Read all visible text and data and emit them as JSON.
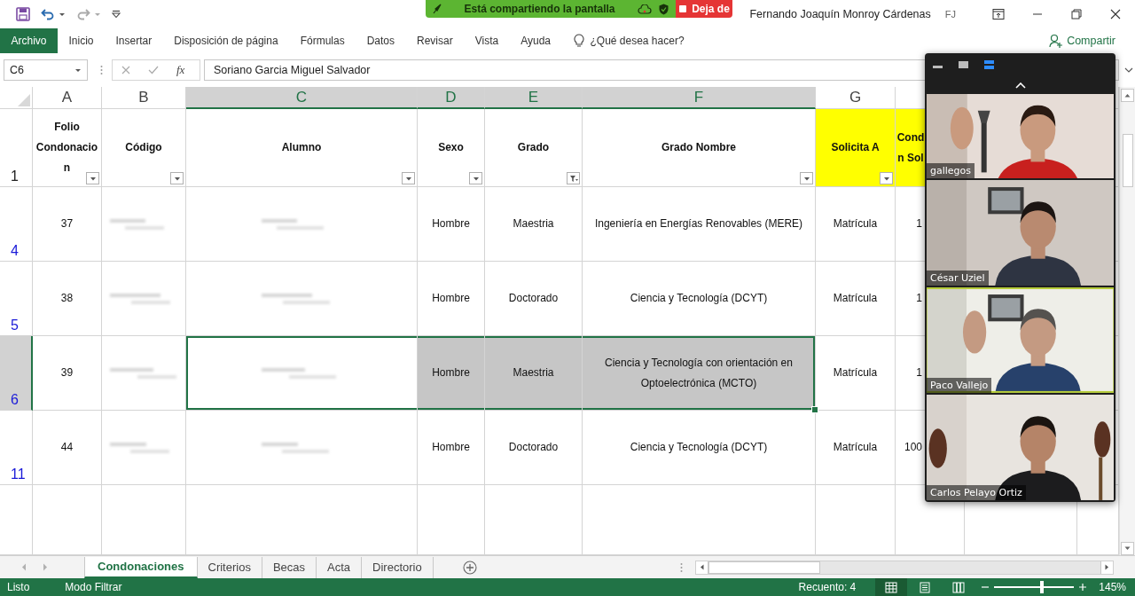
{
  "window": {
    "user": "Fernando Joaquín Monroy Cárdenas",
    "initials": "FJ"
  },
  "share_banner": {
    "text": "Está compartiendo la pantalla",
    "stop_button": "Deja de"
  },
  "ribbon": {
    "tabs": [
      {
        "label": "Archivo",
        "selected": true
      },
      {
        "label": "Inicio",
        "selected": false
      },
      {
        "label": "Insertar",
        "selected": false
      },
      {
        "label": "Disposición de página",
        "selected": false
      },
      {
        "label": "Fórmulas",
        "selected": false
      },
      {
        "label": "Datos",
        "selected": false
      },
      {
        "label": "Revisar",
        "selected": false
      },
      {
        "label": "Vista",
        "selected": false
      },
      {
        "label": "Ayuda",
        "selected": false
      }
    ],
    "search": "¿Qué desea hacer?",
    "share": "Compartir"
  },
  "formula_bar": {
    "name_box": "C6",
    "function_button": "fx",
    "value": "Soriano Garcia Miguel Salvador"
  },
  "sheet": {
    "columns": [
      {
        "letter": "A",
        "selected": false
      },
      {
        "letter": "B",
        "selected": false
      },
      {
        "letter": "C",
        "selected": true
      },
      {
        "letter": "D",
        "selected": true
      },
      {
        "letter": "E",
        "selected": true
      },
      {
        "letter": "F",
        "selected": true
      },
      {
        "letter": "G",
        "selected": false
      }
    ],
    "header_row": {
      "number": "1",
      "filtered": false,
      "cells": [
        {
          "text": "Folio Condonacion",
          "filter_active": false
        },
        {
          "text": "Código",
          "filter_active": false
        },
        {
          "text": "Alumno",
          "filter_active": false
        },
        {
          "text": "Sexo",
          "filter_active": false
        },
        {
          "text": "Grado",
          "filter_active": true
        },
        {
          "text": "Grado Nombre",
          "filter_active": false
        },
        {
          "text": "Solicita A",
          "filter_active": false,
          "color": "#ffff00"
        },
        {
          "text": "Cond n Sol",
          "color": "#ffff00"
        }
      ]
    },
    "rows": [
      {
        "number": "4",
        "filtered": true,
        "selected": false,
        "cells": [
          {
            "kind": "text",
            "text": "37",
            "active": false
          },
          {
            "kind": "blurred",
            "active": false
          },
          {
            "kind": "blurred",
            "active": false
          },
          {
            "kind": "text",
            "text": "Hombre",
            "active": false
          },
          {
            "kind": "text",
            "text": "Maestria",
            "active": false
          },
          {
            "kind": "text",
            "text": "Ingeniería en Energías Renovables (MERE)",
            "active": false
          },
          {
            "kind": "text",
            "text": "Matrícula",
            "active": false
          },
          {
            "kind": "text",
            "text": "1",
            "active": false
          }
        ]
      },
      {
        "number": "5",
        "filtered": true,
        "selected": false,
        "cells": [
          {
            "kind": "text",
            "text": "38",
            "active": false
          },
          {
            "kind": "blurred",
            "active": false
          },
          {
            "kind": "blurred",
            "active": false
          },
          {
            "kind": "text",
            "text": "Hombre",
            "active": false
          },
          {
            "kind": "text",
            "text": "Doctorado",
            "active": false
          },
          {
            "kind": "text",
            "text": "Ciencia y Tecnología (DCYT)",
            "active": false
          },
          {
            "kind": "text",
            "text": "Matrícula",
            "active": false
          },
          {
            "kind": "text",
            "text": "1",
            "active": false
          }
        ]
      },
      {
        "number": "6",
        "filtered": true,
        "selected": true,
        "cells": [
          {
            "kind": "text",
            "text": "39",
            "active": false
          },
          {
            "kind": "blurred",
            "active": false
          },
          {
            "kind": "blurred",
            "active": true
          },
          {
            "kind": "text",
            "text": "Hombre",
            "active": false
          },
          {
            "kind": "text",
            "text": "Maestria",
            "active": false
          },
          {
            "kind": "text",
            "text": "Ciencia y Tecnología con orientación en Optoelectrónica (MCTO)",
            "active": false
          },
          {
            "kind": "text",
            "text": "Matrícula",
            "active": false
          },
          {
            "kind": "text",
            "text": "1",
            "active": false
          }
        ]
      },
      {
        "number": "11",
        "filtered": true,
        "selected": false,
        "cells": [
          {
            "kind": "text",
            "text": "44",
            "active": false
          },
          {
            "kind": "blurred",
            "active": false
          },
          {
            "kind": "blurred",
            "active": false
          },
          {
            "kind": "text",
            "text": "Hombre",
            "active": false
          },
          {
            "kind": "text",
            "text": "Doctorado",
            "active": false
          },
          {
            "kind": "text",
            "text": "Ciencia y Tecnología (DCYT)",
            "active": false
          },
          {
            "kind": "text",
            "text": "Matrícula",
            "active": false
          },
          {
            "kind": "text",
            "text": "100",
            "active": false
          }
        ]
      }
    ]
  },
  "sheet_tabs": [
    {
      "label": "Condonaciones",
      "selected": true
    },
    {
      "label": "Criterios",
      "selected": false
    },
    {
      "label": "Becas",
      "selected": false
    },
    {
      "label": "Acta",
      "selected": false
    },
    {
      "label": "Directorio",
      "selected": false
    }
  ],
  "status_bar": {
    "mode": "Listo",
    "filter_mode": "Modo Filtrar",
    "count": "Recuento: 4",
    "views": [
      {
        "kind": "normal",
        "selected": true
      },
      {
        "kind": "page_layout",
        "selected": false
      },
      {
        "kind": "page_break",
        "selected": false
      }
    ],
    "zoom": {
      "level": 0.6,
      "reading": "145%"
    }
  },
  "zoom_panel": {
    "view_buttons": [
      {
        "kind": "minimize",
        "selected": false
      },
      {
        "kind": "speaker",
        "selected": false
      },
      {
        "kind": "gallery",
        "selected": true
      }
    ],
    "participants": [
      {
        "name": "gallegos",
        "active": false
      },
      {
        "name": "César Uziel",
        "active": false
      },
      {
        "name": "Paco Vallejo",
        "active": true
      },
      {
        "name": "Carlos Pelayo Ortiz",
        "active": false
      }
    ]
  }
}
